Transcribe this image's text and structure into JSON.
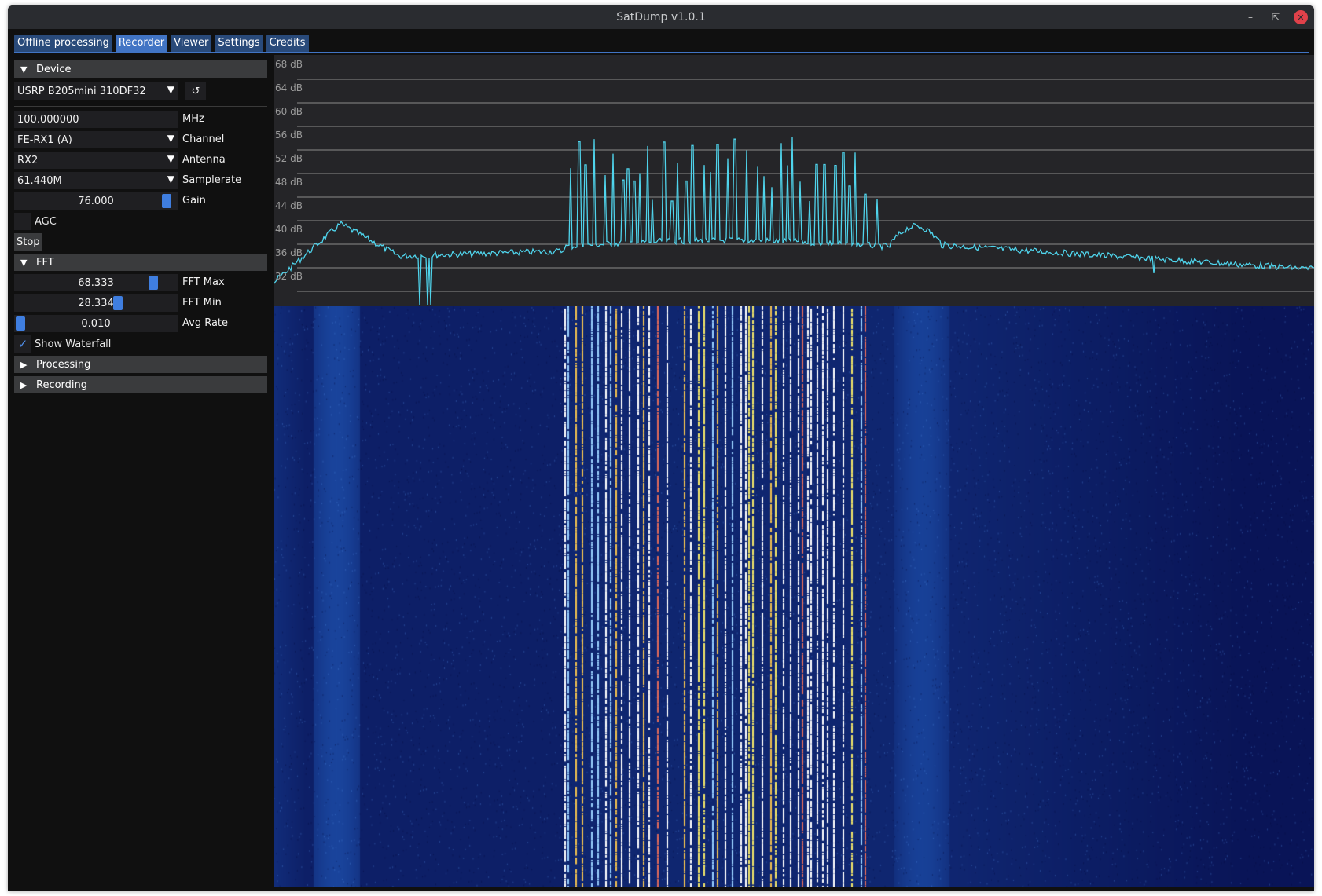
{
  "window": {
    "title": "SatDump v1.0.1"
  },
  "tabs": [
    {
      "label": "Offline processing"
    },
    {
      "label": "Recorder"
    },
    {
      "label": "Viewer"
    },
    {
      "label": "Settings"
    },
    {
      "label": "Credits"
    }
  ],
  "sidebar": {
    "device_header": "Device",
    "device_select": "USRP B205mini 310DF32",
    "frequency": {
      "value": "100.000000",
      "unit": "MHz"
    },
    "channel": {
      "value": "FE-RX1 (A)",
      "label": "Channel"
    },
    "antenna": {
      "value": "RX2",
      "label": "Antenna"
    },
    "samplerate": {
      "value": "61.440M",
      "label": "Samplerate"
    },
    "gain": {
      "value": "76.000",
      "label": "Gain",
      "fraction": 0.96
    },
    "agc": {
      "label": "AGC",
      "checked": false
    },
    "stop_label": "Stop",
    "fft_header": "FFT",
    "fft_max": {
      "value": "68.333",
      "label": "FFT Max",
      "fraction": 0.87
    },
    "fft_min": {
      "value": "28.334",
      "label": "FFT Min",
      "fraction": 0.64
    },
    "avg_rate": {
      "value": "0.010",
      "label": "Avg Rate",
      "fraction": 0.0
    },
    "show_waterfall": {
      "label": "Show Waterfall",
      "checked": true
    },
    "processing_header": "Processing",
    "recording_header": "Recording"
  },
  "spectrum": {
    "db_labels": [
      "68 dB",
      "64 dB",
      "60 dB",
      "56 dB",
      "52 dB",
      "48 dB",
      "44 dB",
      "40 dB",
      "36 dB",
      "32 dB"
    ],
    "line_color": "#4fd4ec"
  },
  "colors": {
    "accent": "#4174c4",
    "tab_inactive": "#294a7a",
    "panel_bg": "#101010",
    "header_bg": "#3a3b3d",
    "field_bg": "#1f1f22",
    "waterfall_bg": "#050a4e"
  }
}
